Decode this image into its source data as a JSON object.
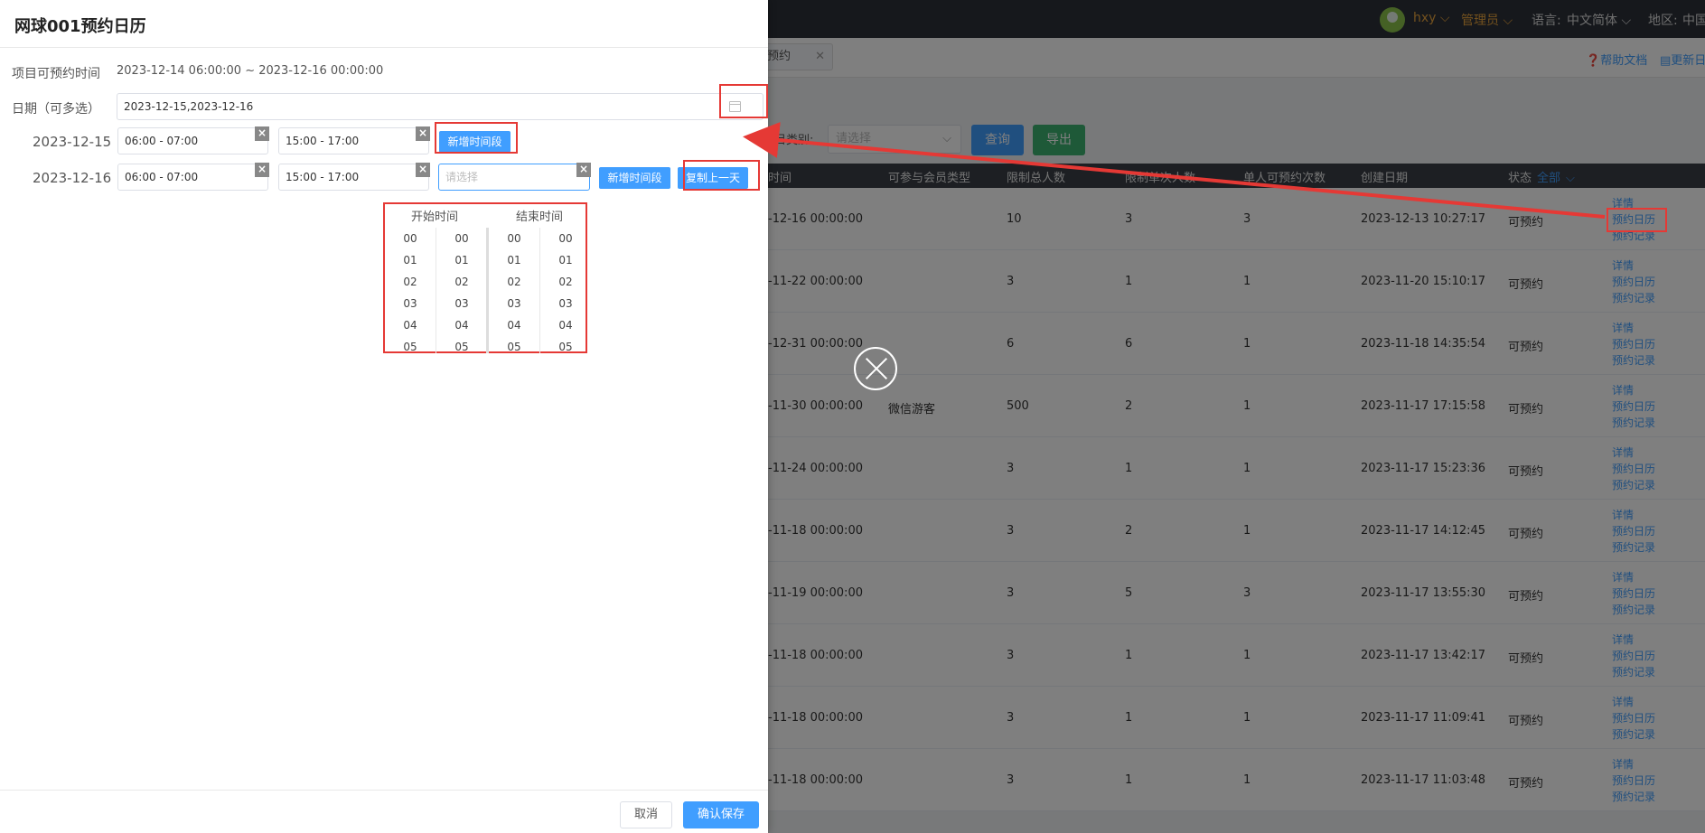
{
  "topbar": {
    "username": "hxy",
    "role": "管理员",
    "language_label": "语言:",
    "language_value": "中文简体",
    "region_label": "地区:",
    "region_value": "中国"
  },
  "tabbar": {
    "tab_label": "预约",
    "help_doc": "帮助文档",
    "update_log": "更新日"
  },
  "filter": {
    "label": "项目类别:",
    "placeholder": "请选择",
    "query": "查询",
    "export": "导出"
  },
  "table": {
    "headers": {
      "time": "时间",
      "member_type": "可参与会员类型",
      "total_limit": "限制总人数",
      "single_limit": "限制单次人数",
      "per_person": "单人可预约次数",
      "created": "创建日期",
      "status": "状态",
      "status_filter": "全部"
    },
    "link_labels": {
      "detail": "详情",
      "calendar": "预约日历",
      "record": "预约记录"
    },
    "rows": [
      {
        "end": "-12-16 00:00:00",
        "member": "",
        "total": "10",
        "single": "3",
        "per": "3",
        "created": "2023-12-13 10:27:17",
        "status": "可预约"
      },
      {
        "end": "-11-22 00:00:00",
        "member": "",
        "total": "3",
        "single": "1",
        "per": "1",
        "created": "2023-11-20 15:10:17",
        "status": "可预约"
      },
      {
        "end": "-12-31 00:00:00",
        "member": "",
        "total": "6",
        "single": "6",
        "per": "1",
        "created": "2023-11-18 14:35:54",
        "status": "可预约"
      },
      {
        "end": "-11-30 00:00:00",
        "member": "微信游客",
        "total": "500",
        "single": "2",
        "per": "1",
        "created": "2023-11-17 17:15:58",
        "status": "可预约"
      },
      {
        "end": "-11-24 00:00:00",
        "member": "",
        "total": "3",
        "single": "1",
        "per": "1",
        "created": "2023-11-17 15:23:36",
        "status": "可预约"
      },
      {
        "end": "-11-18 00:00:00",
        "member": "",
        "total": "3",
        "single": "2",
        "per": "1",
        "created": "2023-11-17 14:12:45",
        "status": "可预约"
      },
      {
        "end": "-11-19 00:00:00",
        "member": "",
        "total": "3",
        "single": "5",
        "per": "3",
        "created": "2023-11-17 13:55:30",
        "status": "可预约"
      },
      {
        "end": "-11-18 00:00:00",
        "member": "",
        "total": "3",
        "single": "1",
        "per": "1",
        "created": "2023-11-17 13:42:17",
        "status": "可预约"
      },
      {
        "end": "-11-18 00:00:00",
        "member": "",
        "total": "3",
        "single": "1",
        "per": "1",
        "created": "2023-11-17 11:09:41",
        "status": "可预约"
      },
      {
        "end": "-11-18 00:00:00",
        "member": "",
        "total": "3",
        "single": "1",
        "per": "1",
        "created": "2023-11-17 11:03:48",
        "status": "可预约"
      }
    ]
  },
  "drawer": {
    "title": "网球001预约日历",
    "bookable_label": "项目可预约时间",
    "bookable_value": "2023-12-14 06:00:00 ~ 2023-12-16 00:00:00",
    "date_label": "日期（可多选）",
    "date_value": "2023-12-15,2023-12-16",
    "day1": {
      "date": "2023-12-15",
      "slot1": "06:00 - 07:00",
      "slot2": "15:00 - 17:00",
      "add_btn": "新增时间段"
    },
    "day2": {
      "date": "2023-12-16",
      "slot1": "06:00 - 07:00",
      "slot2": "15:00 - 17:00",
      "slot3_placeholder": "请选择",
      "add_btn": "新增时间段",
      "copy_btn": "复制上一天"
    },
    "picker": {
      "start_label": "开始时间",
      "end_label": "结束时间",
      "hours": [
        "00",
        "01",
        "02",
        "03",
        "04",
        "05"
      ],
      "minutes": [
        "00",
        "01",
        "02",
        "03",
        "04",
        "05"
      ]
    },
    "footer": {
      "cancel": "取消",
      "save": "确认保存"
    }
  }
}
